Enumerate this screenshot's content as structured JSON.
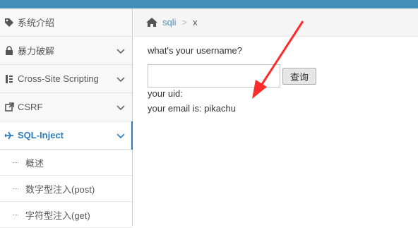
{
  "sidebar": {
    "items": [
      {
        "label": "系统介绍",
        "icon": "tag-icon"
      },
      {
        "label": "暴力破解",
        "icon": "lock-icon"
      },
      {
        "label": "Cross-Site Scripting",
        "icon": "sitemap-icon"
      },
      {
        "label": "CSRF",
        "icon": "external-link-icon"
      },
      {
        "label": "SQL-Inject",
        "icon": "plane-icon"
      }
    ],
    "sub_items": [
      {
        "label": "概述"
      },
      {
        "label": "数字型注入(post)"
      },
      {
        "label": "字符型注入(get)"
      }
    ]
  },
  "breadcrumb": {
    "link": "sqli",
    "separator": ">",
    "current": "x"
  },
  "form": {
    "question": "what's your username?",
    "username_value": "",
    "submit_label": "查询"
  },
  "result": {
    "uid_line": "your uid:",
    "email_line": "your email is: pikachu"
  },
  "colors": {
    "topbar": "#438eb9",
    "accent": "#2b7dbc",
    "annotation_arrow": "#ff2a2a"
  }
}
